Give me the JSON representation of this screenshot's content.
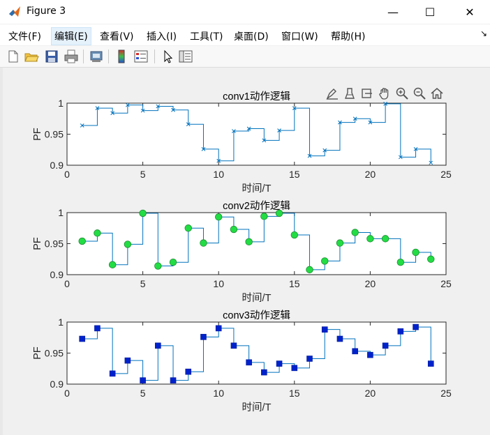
{
  "window": {
    "title": "Figure 3",
    "minimize": "—",
    "maximize": "☐",
    "close": "✕"
  },
  "menu": {
    "items": [
      "文件(F)",
      "编辑(E)",
      "查看(V)",
      "插入(I)",
      "工具(T)",
      "桌面(D)",
      "窗口(W)",
      "帮助(H)"
    ],
    "overflow": "↘"
  },
  "toolbar": {
    "icons": [
      "new-figure-icon",
      "open-file-icon",
      "save-icon",
      "print-icon",
      "print-preview-icon",
      "colorbar-icon",
      "legend-icon",
      "pointer-icon",
      "property-inspector-icon"
    ]
  },
  "axes_toolbar": {
    "icons": [
      "brush-icon",
      "data-cursor-icon",
      "rotate-icon",
      "pan-icon",
      "zoom-in-icon",
      "zoom-out-icon",
      "home-icon"
    ]
  },
  "chart_data": [
    {
      "type": "line",
      "step": true,
      "title": "conv1动作逻辑",
      "xlabel": "时间/T",
      "ylabel": "PF",
      "xlim": [
        0,
        25
      ],
      "ylim": [
        0.9,
        1
      ],
      "xticks": [
        "0",
        "5",
        "10",
        "15",
        "20",
        "25"
      ],
      "yticks": [
        "0.9",
        "0.95",
        "1"
      ],
      "marker": "x",
      "color": "#0072bd",
      "x": [
        1,
        2,
        3,
        4,
        5,
        6,
        7,
        8,
        9,
        10,
        11,
        12,
        13,
        14,
        15,
        16,
        17,
        18,
        19,
        20,
        21,
        22,
        23,
        24
      ],
      "y": [
        0.964,
        0.992,
        0.984,
        0.997,
        0.988,
        0.995,
        0.989,
        0.966,
        0.926,
        0.907,
        0.955,
        0.959,
        0.94,
        0.956,
        0.992,
        0.915,
        0.924,
        0.969,
        0.975,
        0.969,
        0.999,
        0.913,
        0.926,
        0.904
      ]
    },
    {
      "type": "line",
      "step": true,
      "title": "conv2动作逻辑",
      "xlabel": "时间/T",
      "ylabel": "PF",
      "xlim": [
        0,
        25
      ],
      "ylim": [
        0.9,
        1
      ],
      "xticks": [
        "0",
        "5",
        "10",
        "15",
        "20",
        "25"
      ],
      "yticks": [
        "0.9",
        "0.95",
        "1"
      ],
      "marker": "circle",
      "color": "#0072bd",
      "marker_fill": "#22dd44",
      "x": [
        1,
        2,
        3,
        4,
        5,
        6,
        7,
        8,
        9,
        10,
        11,
        12,
        13,
        14,
        15,
        16,
        17,
        18,
        19,
        20,
        21,
        22,
        23,
        24
      ],
      "y": [
        0.954,
        0.967,
        0.916,
        0.949,
        0.999,
        0.914,
        0.92,
        0.975,
        0.951,
        0.993,
        0.973,
        0.953,
        0.994,
        0.999,
        0.964,
        0.908,
        0.922,
        0.951,
        0.968,
        0.958,
        0.958,
        0.92,
        0.936,
        0.925
      ]
    },
    {
      "type": "line",
      "step": true,
      "title": "conv3动作逻辑",
      "xlabel": "时间/T",
      "ylabel": "PF",
      "xlim": [
        0,
        25
      ],
      "ylim": [
        0.9,
        1
      ],
      "xticks": [
        "0",
        "5",
        "10",
        "15",
        "20",
        "25"
      ],
      "yticks": [
        "0.9",
        "0.95",
        "1"
      ],
      "marker": "square",
      "color": "#0072bd",
      "marker_fill": "#0022cc",
      "x": [
        1,
        2,
        3,
        4,
        5,
        6,
        7,
        8,
        9,
        10,
        11,
        12,
        13,
        14,
        15,
        16,
        17,
        18,
        19,
        20,
        21,
        22,
        23,
        24
      ],
      "y": [
        0.973,
        0.99,
        0.917,
        0.938,
        0.906,
        0.962,
        0.906,
        0.92,
        0.976,
        0.99,
        0.962,
        0.935,
        0.919,
        0.933,
        0.926,
        0.941,
        0.988,
        0.973,
        0.953,
        0.947,
        0.962,
        0.985,
        0.992,
        0.933
      ]
    }
  ]
}
